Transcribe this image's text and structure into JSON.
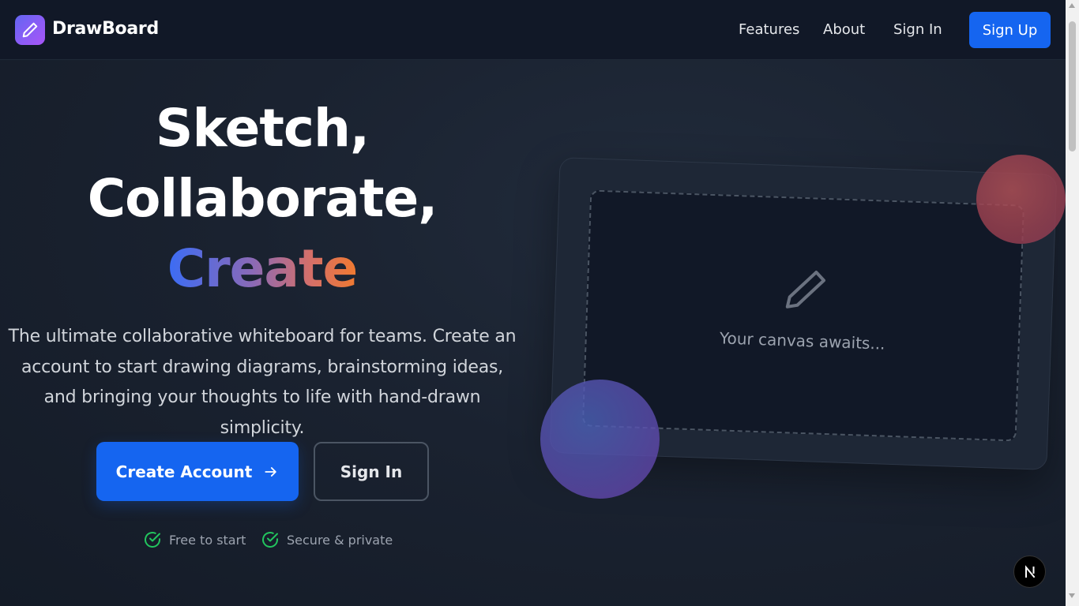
{
  "header": {
    "brand": "DrawBoard",
    "nav": {
      "features": "Features",
      "about": "About",
      "sign_in": "Sign In",
      "sign_up": "Sign Up"
    }
  },
  "hero": {
    "title_line1": "Sketch,",
    "title_line2": "Collaborate,",
    "title_line3": "Create",
    "description": "The ultimate collaborative whiteboard for teams. Create an account to start drawing diagrams, brainstorming ideas, and bringing your thoughts to life with hand-drawn simplicity.",
    "primary_cta": "Create Account",
    "secondary_cta": "Sign In",
    "perks": [
      "Free to start",
      "Secure & private"
    ]
  },
  "illustration": {
    "canvas_placeholder": "Your canvas awaits..."
  },
  "icons": {
    "logo": "pencil-icon",
    "cta_arrow": "arrow-right-icon",
    "perk": "check-circle-icon",
    "canvas": "pencil-icon",
    "dev_badge": "next-logo-icon"
  },
  "colors": {
    "accent": "#1565f0",
    "check": "#22c55e"
  }
}
